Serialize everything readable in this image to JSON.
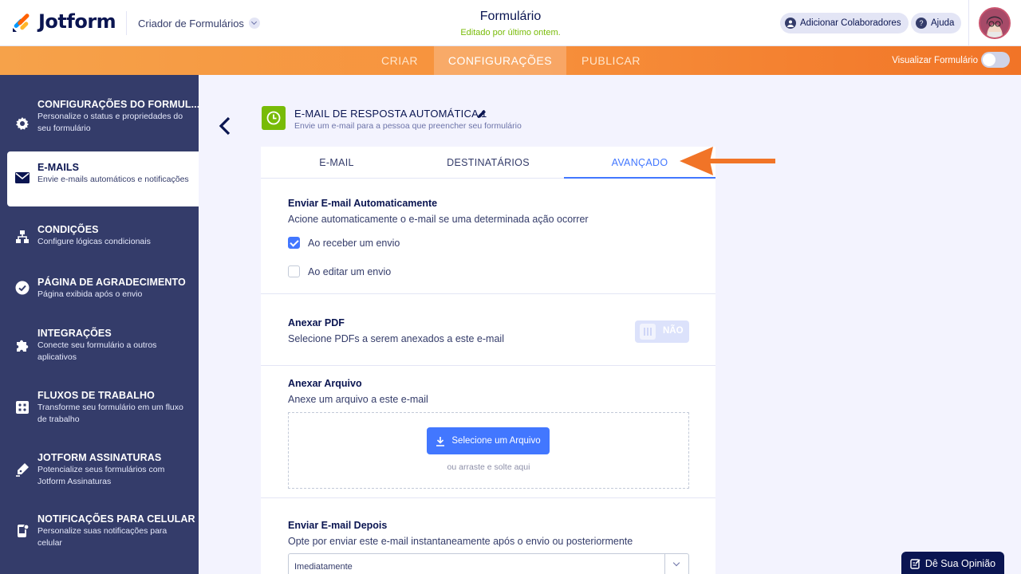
{
  "header": {
    "brand": "Jotform",
    "builder_label": "Criador de Formulários",
    "form_title": "Formulário",
    "form_subtitle": "Editado por último ontem.",
    "add_collaborators": "Adicionar Colaboradores",
    "help": "Ajuda"
  },
  "nav": {
    "tabs": [
      "CRIAR",
      "CONFIGURAÇÕES",
      "PUBLICAR"
    ],
    "active_tab": "CONFIGURAÇÕES",
    "preview_label": "Visualizar Formulário",
    "preview_on": false
  },
  "sidebar": {
    "items": [
      {
        "title": "CONFIGURAÇÕES DO FORMUL...",
        "desc": "Personalize o status e propriedades do seu formulário",
        "icon": "gear-icon"
      },
      {
        "title": "E-MAILS",
        "desc": "Envie e-mails automáticos e notificações",
        "icon": "envelope-icon",
        "active": true
      },
      {
        "title": "CONDIÇÕES",
        "desc": "Configure lógicas condicionais",
        "icon": "sitemap-icon"
      },
      {
        "title": "PÁGINA DE AGRADECIMENTO",
        "desc": "Página exibida após o envio",
        "icon": "check-circle-icon"
      },
      {
        "title": "INTEGRAÇÕES",
        "desc": "Conecte seu formulário a outros aplicativos",
        "icon": "puzzle-icon"
      },
      {
        "title": "FLUXOS DE TRABALHO",
        "desc": "Transforme seu formulário em um fluxo de trabalho",
        "icon": "workflow-icon"
      },
      {
        "title": "JOTFORM ASSINATURAS",
        "desc": "Potencialize seus formulários com Jotform Assinaturas",
        "icon": "pen-icon"
      },
      {
        "title": "NOTIFICAÇÕES PARA CELULAR",
        "desc": "Personalize suas notificações para celular",
        "icon": "mobile-icon"
      }
    ]
  },
  "email": {
    "title": "E-MAIL DE RESPOSTA AUTOMÁTICA 1",
    "subtitle": "Envie um e-mail para a pessoa que preencher seu formulário",
    "tabs": [
      "E-MAIL",
      "DESTINATÁRIOS",
      "AVANÇADO"
    ],
    "active_tab": "AVANÇADO"
  },
  "advanced": {
    "auto_send": {
      "title": "Enviar E-mail Automaticamente",
      "desc": "Acione automaticamente o e-mail se uma determinada ação ocorrer",
      "options": [
        {
          "label": "Ao receber um envio",
          "checked": true
        },
        {
          "label": "Ao editar um envio",
          "checked": false
        }
      ]
    },
    "attach_pdf": {
      "title": "Anexar PDF",
      "desc": "Selecione PDFs a serem anexados a este e-mail",
      "toggle_label": "NÃO",
      "on": false
    },
    "attach_file": {
      "title": "Anexar Arquivo",
      "desc": "Anexe um arquivo a este e-mail",
      "button": "Selecione um Arquivo",
      "hint": "ou arraste e solte aqui"
    },
    "send_later": {
      "title": "Enviar E-mail Depois",
      "desc": "Opte por enviar este e-mail instantaneamente após o envio ou posteriormente",
      "selected": "Imediatamente"
    }
  },
  "feedback": "Dê Sua Opinião",
  "colors": {
    "brand_navy": "#0a1551",
    "sidebar_bg": "#343c6a",
    "accent_blue": "#4277ff",
    "orange": "#f17427",
    "green": "#78bb07"
  }
}
